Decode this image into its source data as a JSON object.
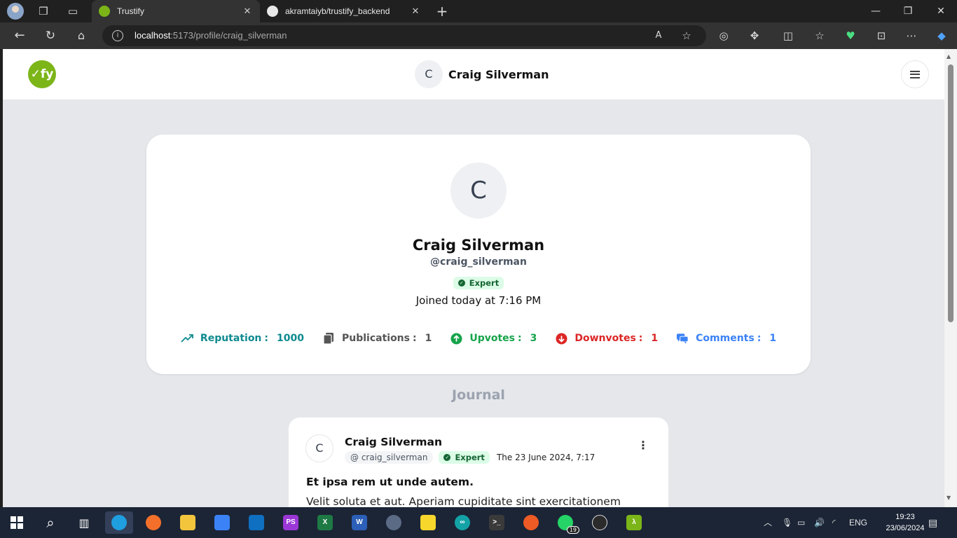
{
  "browser": {
    "tabs": [
      {
        "title": "Trustify",
        "active": true
      },
      {
        "title": "akramtaiyb/trustify_backend",
        "active": false
      }
    ],
    "address": {
      "host": "localhost",
      "path": ":5173/profile/craig_silverman"
    }
  },
  "app": {
    "logo_text": "✓fy",
    "header": {
      "avatar_letter": "C",
      "user_name": "Craig Silverman"
    }
  },
  "profile": {
    "avatar_letter": "C",
    "name": "Craig Silverman",
    "handle": "@craig_silverman",
    "badge": "Expert",
    "joined": "Joined today at 7:16 PM",
    "stats": {
      "reputation": {
        "label": "Reputation",
        "value": "1000",
        "icon": "trending-up-icon"
      },
      "publications": {
        "label": "Publications",
        "value": "1",
        "icon": "documents-icon"
      },
      "upvotes": {
        "label": "Upvotes",
        "value": "3",
        "icon": "arrow-up-circle-icon"
      },
      "downvotes": {
        "label": "Downvotes",
        "value": "1",
        "icon": "arrow-down-circle-icon"
      },
      "comments": {
        "label": "Comments",
        "value": "1",
        "icon": "chat-bubbles-icon"
      }
    }
  },
  "journal": {
    "title": "Journal",
    "posts": [
      {
        "avatar_letter": "C",
        "author": "Craig Silverman",
        "handle": "craig_silverman",
        "badge": "Expert",
        "date": "The 23 June 2024, 7:17",
        "title": "Et ipsa rem ut unde autem.",
        "body": "Velit soluta et aut. Aperiam cupiditate sint exercitationem"
      }
    ]
  },
  "taskbar": {
    "language": "ENG",
    "time": "19:23",
    "date": "23/06/2024",
    "whatsapp_badge": "19"
  },
  "colors": {
    "brand_green": "#7cb518",
    "reputation": "#0e8a8f",
    "publications": "#555555",
    "upvotes": "#16a34a",
    "downvotes": "#dc2626",
    "comments": "#3b82f6"
  }
}
